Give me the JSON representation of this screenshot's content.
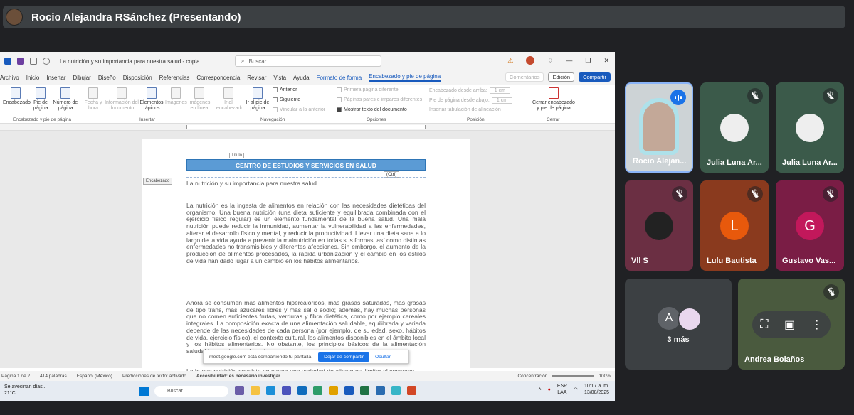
{
  "meeting": {
    "presenter_banner": "Rocio Alejandra RSánchez (Presentando)"
  },
  "word": {
    "doc_title": "La nutrición y su importancia para nuestra salud - copia",
    "search_placeholder": "Buscar",
    "menu": [
      "Archivo",
      "Inicio",
      "Insertar",
      "Dibujar",
      "Diseño",
      "Disposición",
      "Referencias",
      "Correspondencia",
      "Revisar",
      "Vista",
      "Ayuda"
    ],
    "menu_contextual": "Formato de forma",
    "menu_active": "Encabezado y pie de página",
    "comments_label": "Comentarios",
    "editing_label": "Edición",
    "share_label": "Compartir",
    "ribbon": {
      "encabezado": "Encabezado",
      "pie_de_pagina": "Pie de página",
      "numero_de_pagina": "Número de página",
      "fecha_y_hora": "Fecha y hora",
      "informacion_doc": "Información del documento",
      "elementos_rapidos": "Elementos rápidos",
      "imagenes": "Imágenes",
      "imagenes_en_linea": "Imágenes en línea",
      "ir_al_encabezado": "Ir al encabezado",
      "ir_al_pie": "Ir al pie de página",
      "anterior": "Anterior",
      "siguiente": "Siguiente",
      "vincular": "Vincular a la anterior",
      "primera_pagina": "Primera página diferente",
      "paginas_pares": "Páginas pares e impares diferentes",
      "mostrar_texto": "Mostrar texto del documento",
      "enc_desde_arriba": "Encabezado desde arriba:",
      "pie_desde_abajo": "Pie de página desde abajo:",
      "enc_value": "1 cm",
      "pie_value": "1 cm",
      "insertar_tab": "Insertar tabulación de alineación",
      "cerrar": "Cerrar encabezado y pie de página",
      "groups": [
        "Encabezado y pie de página",
        "Insertar",
        "Navegación",
        "Opciones",
        "Posición",
        "Cerrar"
      ]
    },
    "page": {
      "titulo_tag": "Título",
      "encabezado_tag": "Encabezado",
      "ctrl_tag": "(Ctrl)",
      "header_text": "CENTRO DE ESTUDIOS Y SERVICIOS EN SALUD",
      "heading": "La nutrición y su importancia para nuestra salud.",
      "para1": "La nutrición es la ingesta de alimentos en relación con las necesidades dietéticas del organismo. Una buena nutrición (una dieta suficiente y equilibrada combinada con el ejercicio físico regular) es un elemento fundamental de la buena salud. Una mala nutrición puede reducir la inmunidad, aumentar la vulnerabilidad a las enfermedades, alterar el desarrollo físico y mental, y reducir la productividad. Llevar una dieta sana a lo largo de la vida ayuda a prevenir la malnutrición en todas sus formas, así como distintas enfermedades no transmisibles y diferentes afecciones. Sin embargo, el aumento de la producción de alimentos procesados, la rápida urbanización y el cambio en los estilos de vida han dado lugar a un cambio en los hábitos alimentarios.",
      "para2": "Ahora se consumen más alimentos hipercalóricos, más grasas saturadas, más grasas de tipo trans, más azúcares libres y más sal o sodio; además, hay muchas personas que no comen suficientes frutas, verduras y fibra dietética, como por ejemplo cereales integrales. La composición exacta de una alimentación saludable, equilibrada y variada depende de las necesidades de cada persona (por ejemplo, de su edad, sexo, hábitos de vida, ejercicio físico), el contexto cultural, los alimentos disponibles en el ámbito local y los hábitos alimentarios. No obstante, los principios básicos de la alimentación saludable son siempre los mismos.",
      "para3": "La buena nutrición consiste en comer una variedad de alimentos, limitar el consumo"
    },
    "status": {
      "page": "Página 1 de 2",
      "words": "414 palabras",
      "language": "Español (México)",
      "predictions": "Predicciones de texto: activado",
      "accessibility": "Accesibilidad: es necesario investigar",
      "focus": "Concentración",
      "zoom": "100%"
    },
    "notice": {
      "text": "meet.google.com está compartiendo tu pantalla.",
      "stop": "Dejar de compartir",
      "hide": "Ocultar"
    }
  },
  "taskbar": {
    "weather_line1": "Se avecinan días...",
    "weather_line2": "21°C",
    "search": "Buscar",
    "lang1": "ESP",
    "lang2": "LAA",
    "time": "10:17 a. m.",
    "date": "13/08/2025"
  },
  "participants": [
    {
      "name": "Rocio Alejan...",
      "speaking": true
    },
    {
      "name": "Julia Luna Ar...",
      "muted": true
    },
    {
      "name": "Julia Luna Ar...",
      "muted": true
    },
    {
      "name": "Vll S",
      "muted": true
    },
    {
      "name": "Lulu Bautista",
      "muted": true,
      "letter": "L",
      "color": "#e8590c"
    },
    {
      "name": "Gustavo Vas...",
      "muted": true,
      "letter": "G",
      "color": "#c2185b"
    },
    {
      "name": "Andrea Bolaños",
      "muted": true
    }
  ],
  "more": {
    "letter": "A",
    "label": "3 más"
  }
}
